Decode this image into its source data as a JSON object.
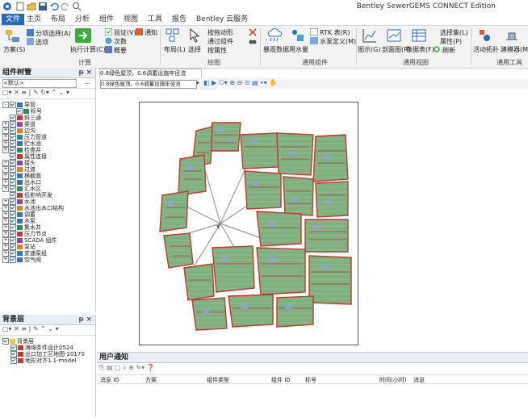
{
  "app": {
    "title": "Bentley SewerGEMS CONNECT Edition"
  },
  "ribbon_tabs": [
    "文件",
    "主页",
    "布局",
    "分析",
    "组件",
    "视图",
    "工具",
    "报告",
    "Bentley 云服务"
  ],
  "ribbon": {
    "calc": {
      "scenario": "方案(S)",
      "options_select": "分项选择(A)",
      "options": "选项",
      "run": "执行计算(C)",
      "validate": "验证(V)",
      "notify": "通知",
      "count": "次数",
      "summary": "概要",
      "group": "计算"
    },
    "drawing": {
      "layout": "布局(L)",
      "select": "选择",
      "drag": "按拖动形",
      "via": "通过组件",
      "prop": "按属性",
      "group": "绘图"
    },
    "tools_grp": {
      "rain": "暴雨数据",
      "water": "用水量",
      "rtk": "RTK 表(R)",
      "hydro": "水泵定义(M)",
      "group": "通用组件"
    },
    "view": {
      "graph": "图示(G)",
      "profile": "剖面图(R)",
      "table": "数据表(F)",
      "select_set": "选择集(L)",
      "property": "属性(P)",
      "refresh": "刷新",
      "group": "通用视图"
    },
    "tools": {
      "active": "活动拓扑",
      "build": "建模器(M)",
      "group": "通用工具"
    }
  },
  "element_panel": {
    "title": "组件树管",
    "filter": "<默认>",
    "items": [
      {
        "label": "导管",
        "level": 0,
        "expand": "-"
      },
      {
        "label": "标号",
        "level": 1,
        "expand": ""
      },
      {
        "label": "斜三通",
        "level": 0,
        "expand": ""
      },
      {
        "label": "渠道",
        "level": 0,
        "expand": "+"
      },
      {
        "label": "边沟",
        "level": 0,
        "expand": "+"
      },
      {
        "label": "压力管道",
        "level": 0,
        "expand": "+"
      },
      {
        "label": "贮水池",
        "level": 0,
        "expand": "+"
      },
      {
        "label": "检查井",
        "level": 0,
        "expand": "+"
      },
      {
        "label": "属性连接",
        "level": 0,
        "expand": ""
      },
      {
        "label": "接头",
        "level": 0,
        "expand": "+"
      },
      {
        "label": "过渡",
        "level": 0,
        "expand": "+"
      },
      {
        "label": "横截面",
        "level": 0,
        "expand": "+"
      },
      {
        "label": "出水口",
        "level": 0,
        "expand": "+"
      },
      {
        "label": "汇水区",
        "level": 0,
        "expand": "+"
      },
      {
        "label": "低影响开发",
        "level": 0,
        "expand": ""
      },
      {
        "label": "水池",
        "level": 0,
        "expand": "+"
      },
      {
        "label": "水池出水口结构",
        "level": 0,
        "expand": "+"
      },
      {
        "label": "调蓄",
        "level": 0,
        "expand": "+"
      },
      {
        "label": "水泵",
        "level": 0,
        "expand": "+"
      },
      {
        "label": "集水井",
        "level": 0,
        "expand": "+"
      },
      {
        "label": "压力节点",
        "level": 0,
        "expand": "+"
      },
      {
        "label": "SCADA 组件",
        "level": 0,
        "expand": "+"
      },
      {
        "label": "泵站",
        "level": 0,
        "expand": "+"
      },
      {
        "label": "变速泵组",
        "level": 0,
        "expand": "+"
      },
      {
        "label": "空气阀",
        "level": 0,
        "expand": "+"
      }
    ]
  },
  "background_panel": {
    "title": "背景层",
    "items": [
      {
        "label": "背景层",
        "level": 0
      },
      {
        "label": "海绵条件设计0524",
        "level": 1
      },
      {
        "label": "出口加工区地图-20170",
        "level": 1
      },
      {
        "label": "地形对齐1.1-model",
        "level": 1
      }
    ]
  },
  "drawing": {
    "doc_tab": "0.8绿色屋顶，0.6调蓄设施年径流",
    "scenario_select": "0.8绿色屋顶，0.6调蓄设施年径流"
  },
  "notification": {
    "title": "用户通知",
    "columns": [
      "消息 ID",
      "方案",
      "组件类型",
      "组件 ID",
      "标号",
      "时间(小时)",
      "消息"
    ]
  },
  "colors": {
    "accent": "#2b6cb8",
    "pipe": "#c0392b",
    "area_fill": "#7fb07f",
    "node": "#8fa8cc"
  }
}
